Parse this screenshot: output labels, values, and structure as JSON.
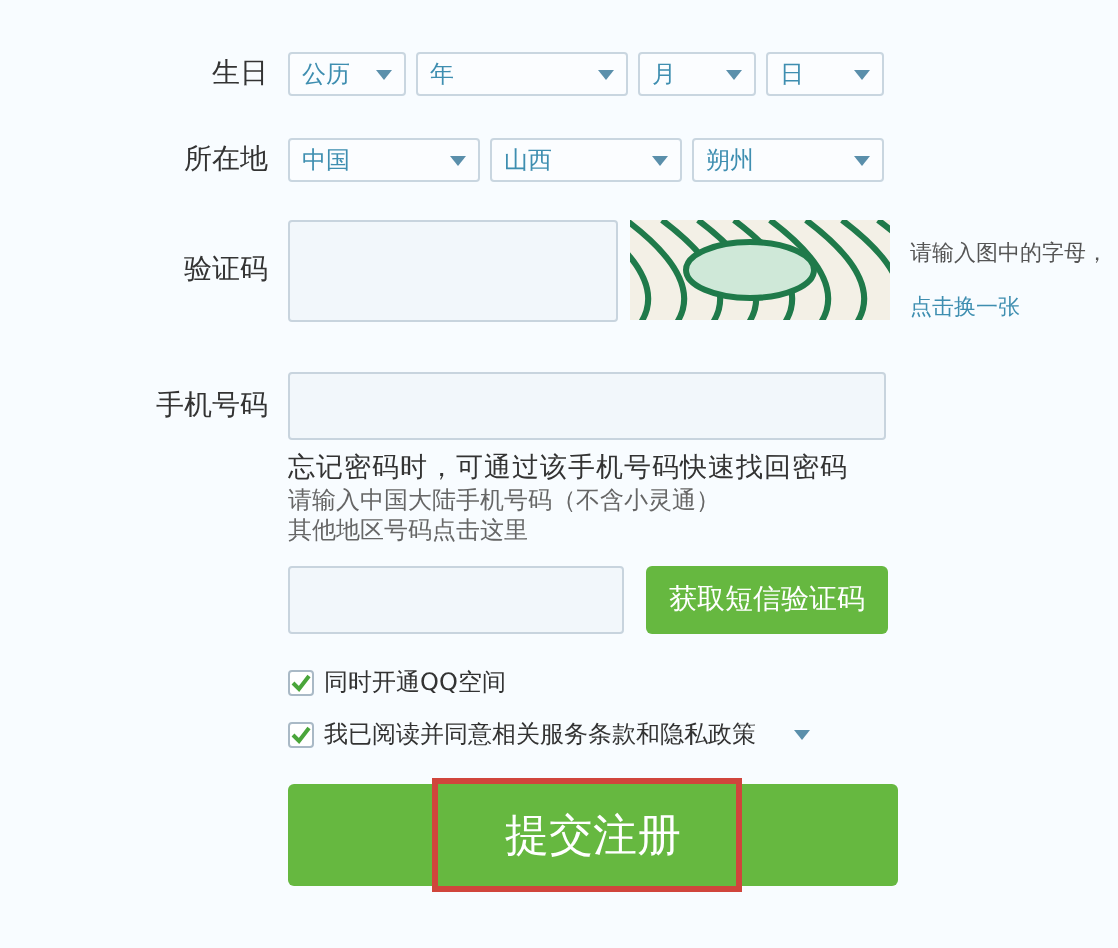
{
  "birthday": {
    "label": "生日",
    "selects": [
      {
        "value": "公历"
      },
      {
        "value": "年"
      },
      {
        "value": "月"
      },
      {
        "value": "日"
      }
    ]
  },
  "location": {
    "label": "所在地",
    "selects": [
      {
        "value": "中国"
      },
      {
        "value": "山西"
      },
      {
        "value": "朔州"
      }
    ]
  },
  "captcha": {
    "label": "验证码",
    "hint": "请输入图中的字母，",
    "refresh_link": "点击换一张"
  },
  "phone": {
    "label": "手机号码",
    "note": "忘记密码时，可通过该手机号码快速找回密码",
    "hint": "请输入中国大陆手机号码（不含小灵通）",
    "other_region": "其他地区号码",
    "other_region_link": "点击这里"
  },
  "sms": {
    "button": "获取短信验证码"
  },
  "options": [
    {
      "label": "同时开通QQ空间",
      "checked": true,
      "dropdown": false
    },
    {
      "label": "我已阅读并同意相关服务条款和隐私政策",
      "checked": true,
      "dropdown": true
    }
  ],
  "submit": {
    "label": "提交注册",
    "highlighted": true
  }
}
